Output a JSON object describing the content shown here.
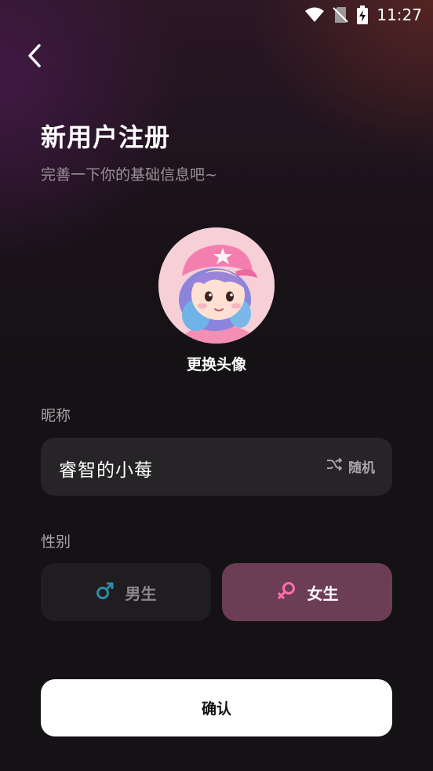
{
  "status_bar": {
    "time": "11:27",
    "icons": [
      "wifi-icon",
      "no-sim-icon",
      "battery-charging-icon"
    ]
  },
  "nav": {
    "back_icon": "chevron-left-icon"
  },
  "header": {
    "title": "新用户注册",
    "subtitle": "完善一下你的基础信息吧~"
  },
  "avatar": {
    "change_label": "更换头像"
  },
  "nickname": {
    "label": "昵称",
    "value": "睿智的小莓",
    "random_label": "随机",
    "random_icon": "shuffle-icon"
  },
  "gender": {
    "label": "性别",
    "options": [
      {
        "label": "男生",
        "icon": "male-icon",
        "selected": false,
        "icon_color": "#2f8ba6"
      },
      {
        "label": "女生",
        "icon": "female-icon",
        "selected": true,
        "icon_color": "#ff6fae"
      }
    ]
  },
  "confirm_label": "确认",
  "colors": {
    "selected_gender_bg": "#6b3e56",
    "unselected_gender_bg": "#1f1d1f",
    "input_bg": "#262426",
    "confirm_bg": "#ffffff"
  }
}
